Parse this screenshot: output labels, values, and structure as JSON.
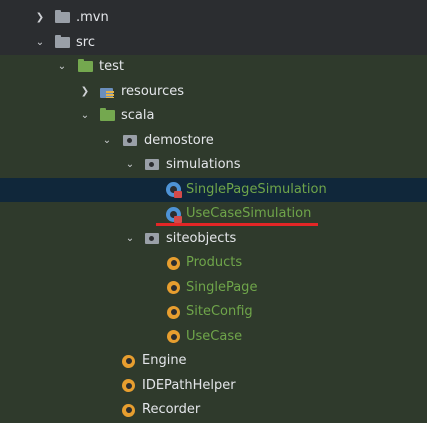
{
  "tree": {
    "items": [
      {
        "label": "mvn_label",
        "text": ".mvn"
      },
      {
        "label": "src",
        "text": "src"
      },
      {
        "label": "test",
        "text": "test"
      },
      {
        "label": "resources",
        "text": "resources"
      },
      {
        "label": "scala",
        "text": "scala"
      },
      {
        "label": "demostore",
        "text": "demostore"
      },
      {
        "label": "simulations",
        "text": "simulations"
      },
      {
        "label": "single_page_simulation",
        "text": "SinglePageSimulation"
      },
      {
        "label": "use_case_simulation",
        "text": "UseCaseSimulation"
      },
      {
        "label": "siteobjects",
        "text": "siteobjects"
      },
      {
        "label": "products",
        "text": "Products"
      },
      {
        "label": "single_page",
        "text": "SinglePage"
      },
      {
        "label": "site_config",
        "text": "SiteConfig"
      },
      {
        "label": "use_case",
        "text": "UseCase"
      },
      {
        "label": "engine",
        "text": "Engine"
      },
      {
        "label": "ide_path_helper",
        "text": "IDEPathHelper"
      },
      {
        "label": "recorder",
        "text": "Recorder"
      }
    ]
  },
  "icons": {
    "folder": "folder-icon",
    "package": "package-icon",
    "resources": "resources-folder-icon",
    "scala_class": "scala-class-icon",
    "scala_object": "scala-object-icon"
  },
  "colors": {
    "background": "#2b2d30",
    "green_row": "#2f3a2c",
    "selected_row": "#10273a",
    "green_text": "#6fa54a",
    "annotation_underline": "#e32626"
  }
}
